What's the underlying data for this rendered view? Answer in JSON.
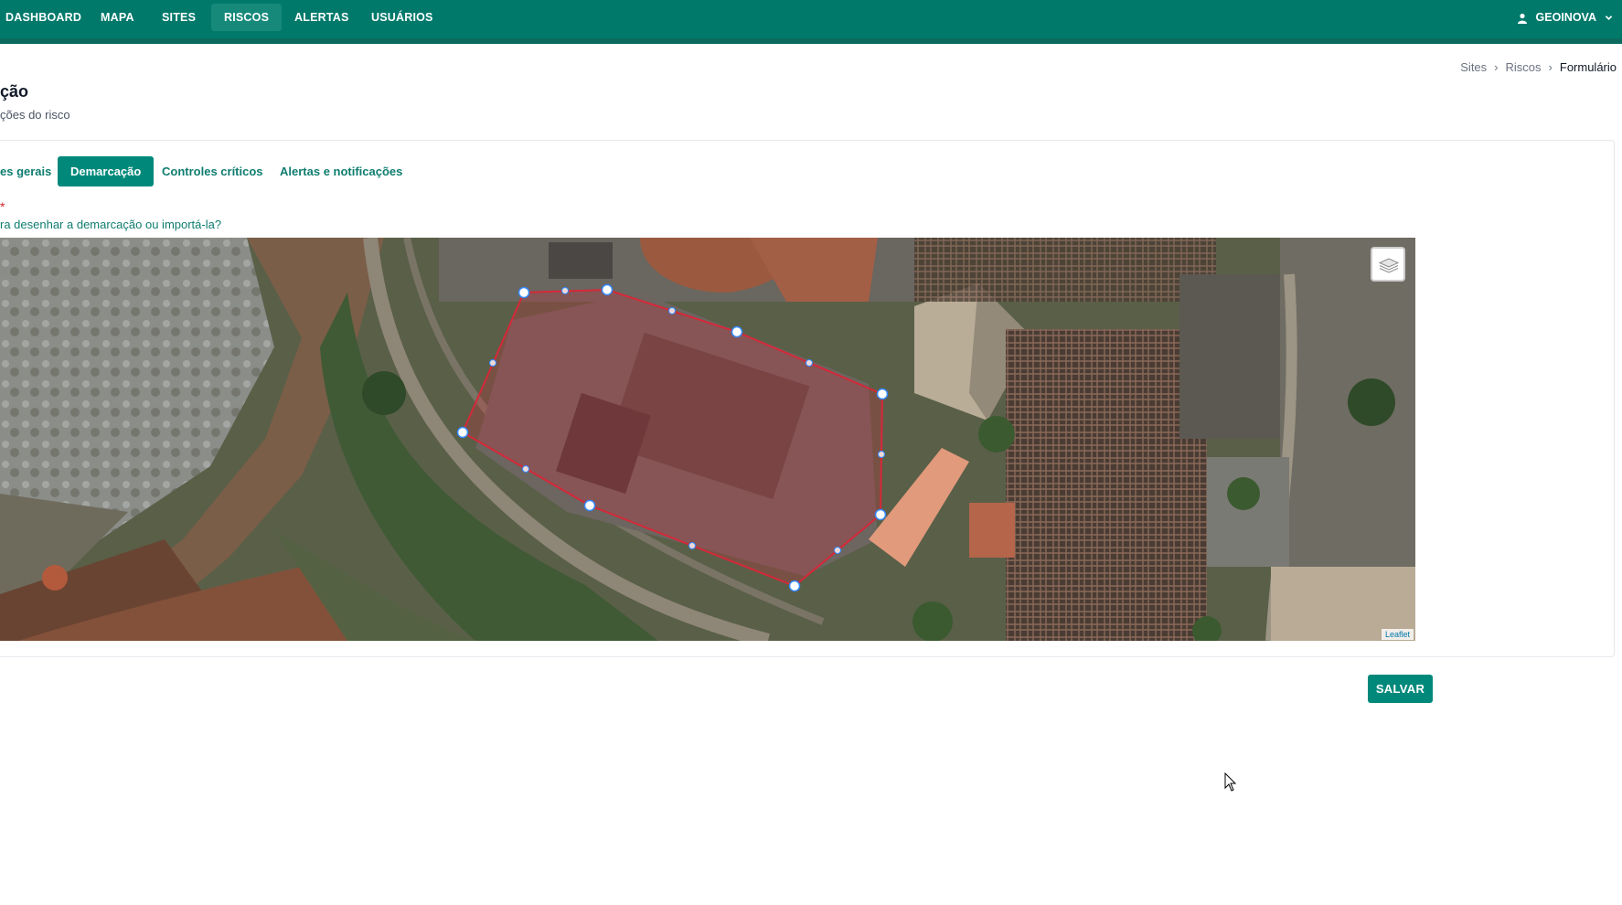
{
  "nav": {
    "items": [
      {
        "label": "DASHBOARD"
      },
      {
        "label": "MAPA"
      },
      {
        "label": "SITES"
      },
      {
        "label": "RISCOS",
        "active": true
      },
      {
        "label": "ALERTAS"
      },
      {
        "label": "USUÁRIOS"
      }
    ],
    "user": "GEOINOVA"
  },
  "breadcrumb": {
    "items": [
      "Sites",
      "Riscos"
    ],
    "current": "Formulário"
  },
  "page": {
    "title": "ção",
    "subtitle": "ções do risco"
  },
  "tabs": [
    {
      "label": "es gerais"
    },
    {
      "label": "Demarcação",
      "active": true
    },
    {
      "label": "Controles críticos"
    },
    {
      "label": "Alertas e notificações"
    }
  ],
  "form": {
    "required_mark": "*",
    "help_link": "ra desenhar a demarcação ou importá-la?"
  },
  "map": {
    "attribution": "Leaflet",
    "layers_icon": "layers-icon",
    "polygon_color": "#d62839"
  },
  "actions": {
    "save_label": "SALVAR"
  },
  "colors": {
    "primary": "#00796b",
    "primary_button": "#00897b",
    "link": "#0f7d6f"
  }
}
